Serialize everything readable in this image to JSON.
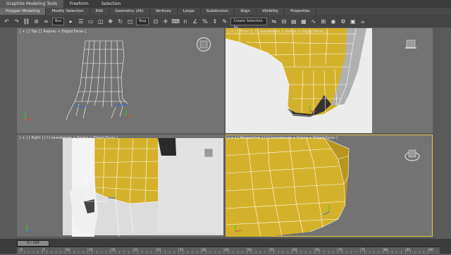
{
  "ribbon": {
    "tabs": [
      "Graphite Modeling Tools",
      "Freeform",
      "Selection"
    ]
  },
  "panels": [
    "Polygon Modeling",
    "Modify Selection",
    "Edit",
    "Geometry (All)",
    "Vertices",
    "Loops",
    "Subdivision",
    "Align",
    "Visibility",
    "Properties"
  ],
  "toolbar": {
    "selection_filter": "Все",
    "view_select": "Вид",
    "named_selection": "Create Selection Se"
  },
  "viewports": {
    "top_left": "[ + ] [ Top ] [ Каркас + Edged Faces ]",
    "top_right": "[ + ] [ Front ] [ Сглаживание + блики + Edged Faces ]",
    "bottom_left": "[ + ] [ Right ] [ Сглаживание + блики + Edged Faces ]",
    "bottom_right": "[ + ] [ Perspective ] [ Сглаживание + блики + Edged Faces ]"
  },
  "timeline": {
    "slider_label": "0 / 100",
    "ticks": [
      "0",
      "5",
      "10",
      "15",
      "20",
      "25",
      "30",
      "35",
      "40",
      "45",
      "50",
      "55",
      "60",
      "65",
      "70",
      "75",
      "80",
      "85",
      "90"
    ]
  },
  "colors": {
    "mesh_yellow": "#d4b12a",
    "wire_white": "#ffffff",
    "active_border": "#e6c84a"
  }
}
